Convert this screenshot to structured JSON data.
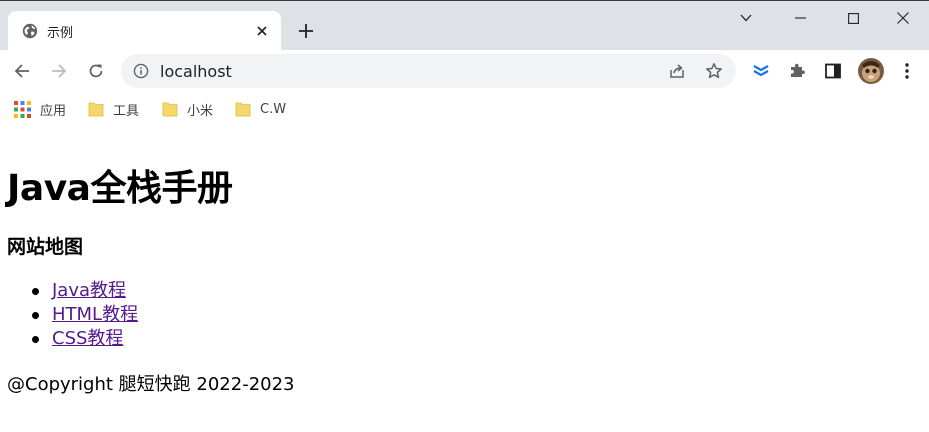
{
  "browser": {
    "tab": {
      "title": "示例",
      "favicon": "globe-icon",
      "close_icon": "close-icon"
    },
    "new_tab_icon": "plus-icon",
    "window_controls": [
      "chevron-down-icon",
      "minimize-icon",
      "maximize-icon",
      "close-icon"
    ],
    "toolbar": {
      "back_icon": "arrow-left-icon",
      "forward_icon": "arrow-right-icon",
      "reload_icon": "reload-icon",
      "url": "localhost",
      "site_info_icon": "info-icon",
      "share_icon": "share-icon",
      "bookmark_star_icon": "star-icon",
      "extensions": [
        "layers-extension-icon",
        "puzzle-icon",
        "sidepanel-icon"
      ],
      "avatar": "profile-avatar",
      "menu_icon": "kebab-menu-icon"
    },
    "bookmarks": [
      {
        "label": "应用",
        "icon": "apps-grid-icon"
      },
      {
        "label": "工具",
        "icon": "folder-icon"
      },
      {
        "label": "小米",
        "icon": "folder-icon"
      },
      {
        "label": "C.W",
        "icon": "folder-icon"
      }
    ],
    "colors": {
      "tabstrip": "#dee1e6",
      "omnibox": "#f1f3f4",
      "link_visited": "#551a8b",
      "folder": "#f6d76b",
      "extension_blue": "#1a73e8"
    }
  },
  "page": {
    "heading": "Java全栈手册",
    "subheading": "网站地图",
    "links": [
      "Java教程",
      "HTML教程",
      "CSS教程"
    ],
    "footer": "@Copyright 腿短快跑 2022-2023"
  }
}
